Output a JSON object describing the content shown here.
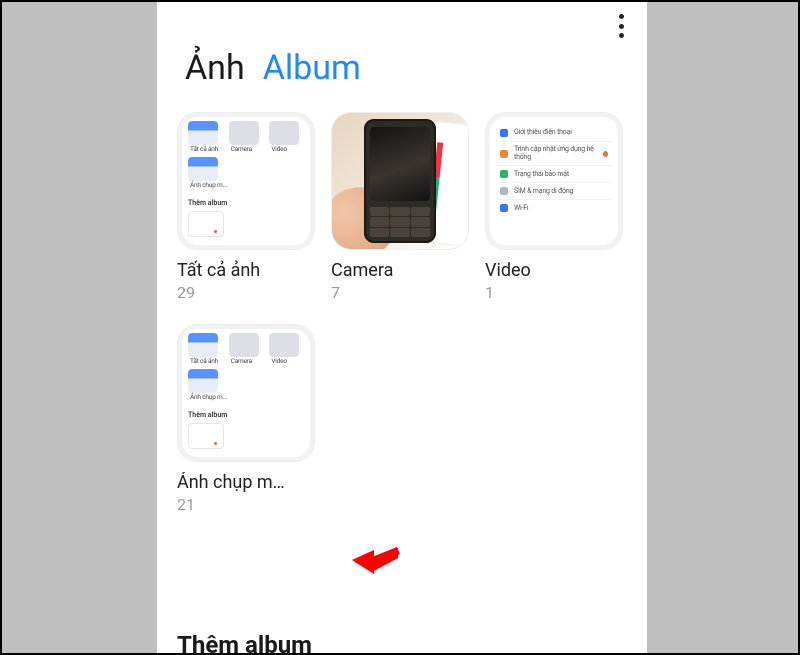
{
  "header": {
    "more_icon": "more-vertical"
  },
  "tabs": {
    "photos_label": "Ảnh",
    "album_label": "Album",
    "active": "Album"
  },
  "albums": [
    {
      "title": "Tất cả ảnh",
      "count": "29",
      "kind": "mini-ui"
    },
    {
      "title": "Camera",
      "count": "7",
      "kind": "photo-hand"
    },
    {
      "title": "Video",
      "count": "1",
      "kind": "settings-ui"
    },
    {
      "title": "Ảnh chụp m…",
      "count": "21",
      "kind": "mini-ui"
    }
  ],
  "mini_ui": {
    "labels": [
      "Tất cả ảnh",
      "Camera",
      "Video"
    ],
    "row2_label": "Ảnh chụp m...",
    "section": "Thêm album"
  },
  "settings_ui": {
    "rows": [
      {
        "color": "blue",
        "text": "Giới thiệu điện thoại"
      },
      {
        "color": "orange",
        "text": "Trình cập nhật ứng dụng hệ thống"
      },
      {
        "color": "green",
        "text": "Trạng thái bảo mật"
      },
      {
        "color": "gray",
        "text": "SIM & mạng di động"
      },
      {
        "color": "blue",
        "text": "Wi-Fi"
      }
    ]
  },
  "section_add_label": "Thêm album",
  "annotation": {
    "arrow_color": "#ff0000",
    "arrow_target": "albums.3"
  }
}
